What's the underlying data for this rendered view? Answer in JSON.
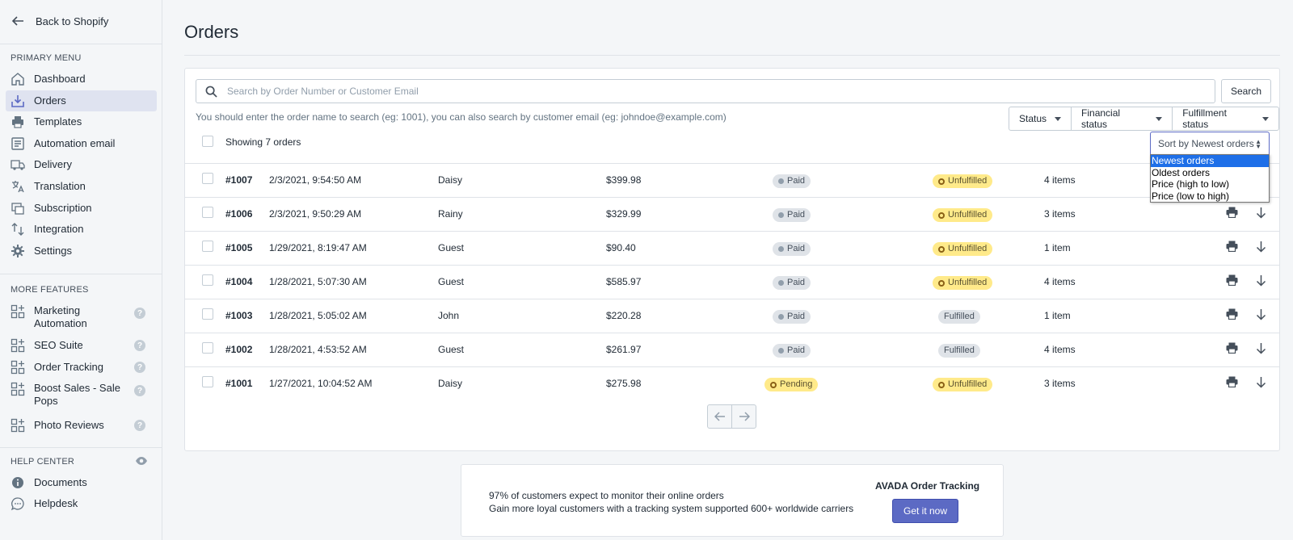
{
  "sidebar": {
    "back_label": "Back to Shopify",
    "primary_heading": "PRIMARY MENU",
    "primary_items": [
      {
        "label": "Dashboard",
        "icon": "home-icon"
      },
      {
        "label": "Orders",
        "icon": "orders-inbox-icon",
        "active": true
      },
      {
        "label": "Templates",
        "icon": "printer-icon"
      },
      {
        "label": "Automation email",
        "icon": "email-automation-icon"
      },
      {
        "label": "Delivery",
        "icon": "truck-icon"
      },
      {
        "label": "Translation",
        "icon": "translate-icon"
      },
      {
        "label": "Subscription",
        "icon": "subscription-icon"
      },
      {
        "label": "Integration",
        "icon": "integration-icon"
      },
      {
        "label": "Settings",
        "icon": "gear-icon"
      }
    ],
    "more_heading": "MORE FEATURES",
    "more_items": [
      {
        "label": "Marketing Automation",
        "icon": "apps-icon"
      },
      {
        "label": "SEO Suite",
        "icon": "apps-icon"
      },
      {
        "label": "Order Tracking",
        "icon": "apps-icon"
      },
      {
        "label": "Boost Sales - Sale Pops",
        "icon": "apps-icon"
      },
      {
        "label": "Photo Reviews",
        "icon": "apps-icon"
      }
    ],
    "help_heading": "HELP CENTER",
    "help_items": [
      {
        "label": "Documents",
        "icon": "info-icon"
      },
      {
        "label": "Helpdesk",
        "icon": "chat-icon"
      }
    ]
  },
  "page": {
    "title": "Orders"
  },
  "search": {
    "placeholder": "Search by Order Number or Customer Email",
    "button_label": "Search",
    "hint": "You should enter the order name to search (eg: 1001), you can also search by customer email (eg: johndoe@example.com)"
  },
  "filters": {
    "status": "Status",
    "financial": "Financial status",
    "fulfillment": "Fulfillment status"
  },
  "sort": {
    "selected": "Sort by Newest orders",
    "options": [
      "Newest orders",
      "Oldest orders",
      "Price (high to low)",
      "Price (low to high)"
    ],
    "highlighted": "Newest orders"
  },
  "showing": "Showing 7 orders",
  "orders": [
    {
      "number": "#1007",
      "date": "2/3/2021, 9:54:50 AM",
      "customer": "Daisy",
      "price": "$399.98",
      "financial": "Paid",
      "fulfillment": "Unfulfilled",
      "items": "4 items"
    },
    {
      "number": "#1006",
      "date": "2/3/2021, 9:50:29 AM",
      "customer": "Rainy",
      "price": "$329.99",
      "financial": "Paid",
      "fulfillment": "Unfulfilled",
      "items": "3 items"
    },
    {
      "number": "#1005",
      "date": "1/29/2021, 8:19:47 AM",
      "customer": "Guest",
      "price": "$90.40",
      "financial": "Paid",
      "fulfillment": "Unfulfilled",
      "items": "1 item"
    },
    {
      "number": "#1004",
      "date": "1/28/2021, 5:07:30 AM",
      "customer": "Guest",
      "price": "$585.97",
      "financial": "Paid",
      "fulfillment": "Unfulfilled",
      "items": "4 items"
    },
    {
      "number": "#1003",
      "date": "1/28/2021, 5:05:02 AM",
      "customer": "John",
      "price": "$220.28",
      "financial": "Paid",
      "fulfillment": "Fulfilled",
      "items": "1 item"
    },
    {
      "number": "#1002",
      "date": "1/28/2021, 4:53:52 AM",
      "customer": "Guest",
      "price": "$261.97",
      "financial": "Paid",
      "fulfillment": "Fulfilled",
      "items": "4 items"
    },
    {
      "number": "#1001",
      "date": "1/27/2021, 10:04:52 AM",
      "customer": "Daisy",
      "price": "$275.98",
      "financial": "Pending",
      "fulfillment": "Unfulfilled",
      "items": "3 items"
    }
  ],
  "promo": {
    "line1": "97% of customers expect to monitor their online orders",
    "line2": "Gain more loyal customers with a tracking system supported 600+ worldwide carriers",
    "title": "AVADA Order Tracking",
    "button_label": "Get it now"
  },
  "colors": {
    "accent": "#5c6ac4",
    "active_nav": "#dfe3f0",
    "warning_badge": "#ffea8a",
    "neutral_badge": "#dfe3e8"
  }
}
